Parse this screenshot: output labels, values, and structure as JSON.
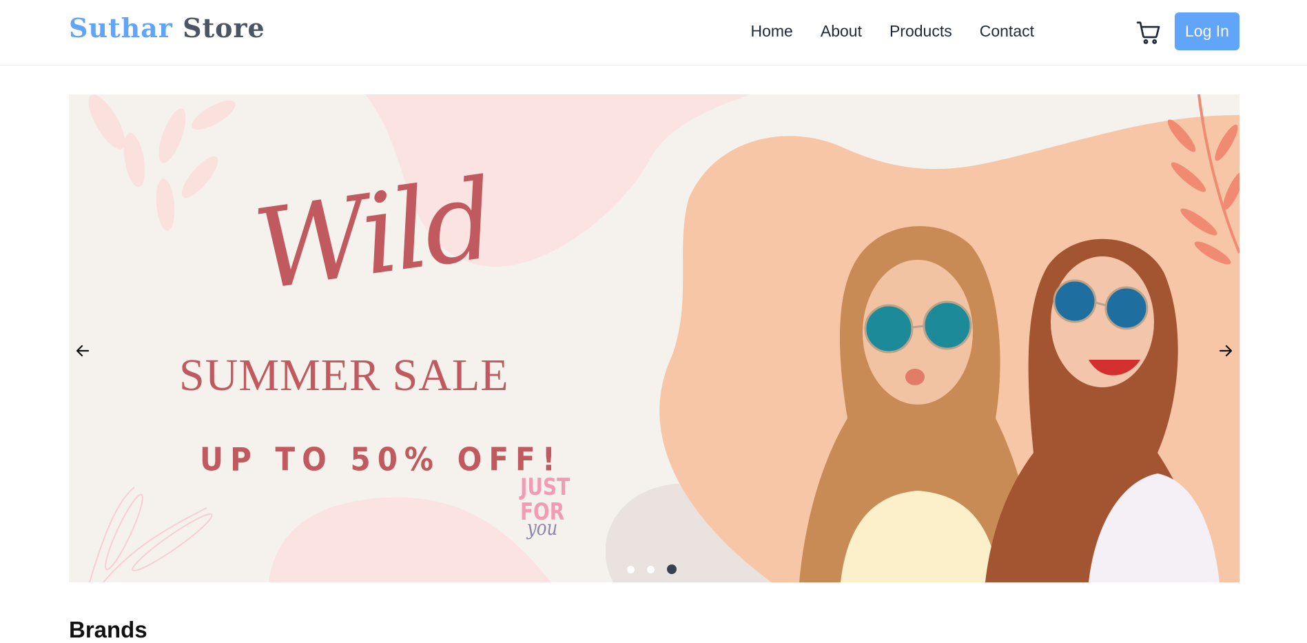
{
  "brand": {
    "part1": "Suthar",
    "part2": "Store"
  },
  "nav": {
    "home": "Home",
    "about": "About",
    "products": "Products",
    "contact": "Contact"
  },
  "login": "Log In",
  "carousel": {
    "script_word": "Wild",
    "title": "SUMMER SALE",
    "subtitle": "UP TO 50% OFF!",
    "badge_line1": "JUST",
    "badge_line2": "FOR",
    "badge_line3": "you",
    "slide_count": 3,
    "active_slide": 3
  },
  "section": {
    "brands_title": "Brands"
  },
  "colors": {
    "accent": "#60a5fa",
    "sale_text": "#c05a5f",
    "peach": "#f7c6a6",
    "pink_blob": "#fbe3e2"
  }
}
